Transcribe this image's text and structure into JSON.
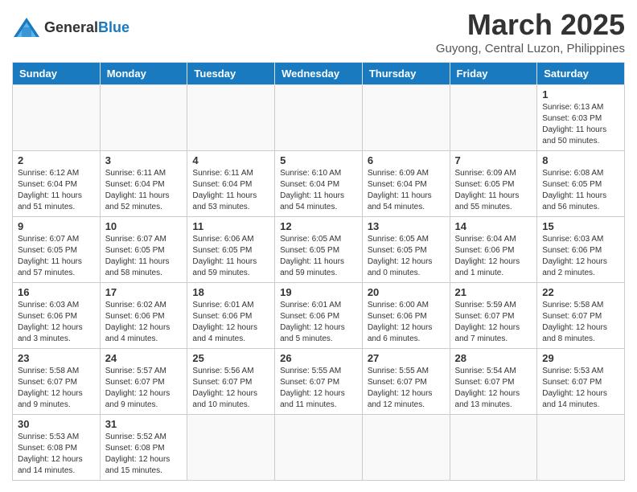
{
  "header": {
    "logo": {
      "general": "General",
      "blue": "Blue"
    },
    "title": "March 2025",
    "location": "Guyong, Central Luzon, Philippines"
  },
  "weekdays": [
    "Sunday",
    "Monday",
    "Tuesday",
    "Wednesday",
    "Thursday",
    "Friday",
    "Saturday"
  ],
  "weeks": [
    [
      {
        "day": "",
        "info": ""
      },
      {
        "day": "",
        "info": ""
      },
      {
        "day": "",
        "info": ""
      },
      {
        "day": "",
        "info": ""
      },
      {
        "day": "",
        "info": ""
      },
      {
        "day": "",
        "info": ""
      },
      {
        "day": "1",
        "info": "Sunrise: 6:13 AM\nSunset: 6:03 PM\nDaylight: 11 hours\nand 50 minutes."
      }
    ],
    [
      {
        "day": "2",
        "info": "Sunrise: 6:12 AM\nSunset: 6:04 PM\nDaylight: 11 hours\nand 51 minutes."
      },
      {
        "day": "3",
        "info": "Sunrise: 6:11 AM\nSunset: 6:04 PM\nDaylight: 11 hours\nand 52 minutes."
      },
      {
        "day": "4",
        "info": "Sunrise: 6:11 AM\nSunset: 6:04 PM\nDaylight: 11 hours\nand 53 minutes."
      },
      {
        "day": "5",
        "info": "Sunrise: 6:10 AM\nSunset: 6:04 PM\nDaylight: 11 hours\nand 54 minutes."
      },
      {
        "day": "6",
        "info": "Sunrise: 6:09 AM\nSunset: 6:04 PM\nDaylight: 11 hours\nand 54 minutes."
      },
      {
        "day": "7",
        "info": "Sunrise: 6:09 AM\nSunset: 6:05 PM\nDaylight: 11 hours\nand 55 minutes."
      },
      {
        "day": "8",
        "info": "Sunrise: 6:08 AM\nSunset: 6:05 PM\nDaylight: 11 hours\nand 56 minutes."
      }
    ],
    [
      {
        "day": "9",
        "info": "Sunrise: 6:07 AM\nSunset: 6:05 PM\nDaylight: 11 hours\nand 57 minutes."
      },
      {
        "day": "10",
        "info": "Sunrise: 6:07 AM\nSunset: 6:05 PM\nDaylight: 11 hours\nand 58 minutes."
      },
      {
        "day": "11",
        "info": "Sunrise: 6:06 AM\nSunset: 6:05 PM\nDaylight: 11 hours\nand 59 minutes."
      },
      {
        "day": "12",
        "info": "Sunrise: 6:05 AM\nSunset: 6:05 PM\nDaylight: 11 hours\nand 59 minutes."
      },
      {
        "day": "13",
        "info": "Sunrise: 6:05 AM\nSunset: 6:05 PM\nDaylight: 12 hours\nand 0 minutes."
      },
      {
        "day": "14",
        "info": "Sunrise: 6:04 AM\nSunset: 6:06 PM\nDaylight: 12 hours\nand 1 minute."
      },
      {
        "day": "15",
        "info": "Sunrise: 6:03 AM\nSunset: 6:06 PM\nDaylight: 12 hours\nand 2 minutes."
      }
    ],
    [
      {
        "day": "16",
        "info": "Sunrise: 6:03 AM\nSunset: 6:06 PM\nDaylight: 12 hours\nand 3 minutes."
      },
      {
        "day": "17",
        "info": "Sunrise: 6:02 AM\nSunset: 6:06 PM\nDaylight: 12 hours\nand 4 minutes."
      },
      {
        "day": "18",
        "info": "Sunrise: 6:01 AM\nSunset: 6:06 PM\nDaylight: 12 hours\nand 4 minutes."
      },
      {
        "day": "19",
        "info": "Sunrise: 6:01 AM\nSunset: 6:06 PM\nDaylight: 12 hours\nand 5 minutes."
      },
      {
        "day": "20",
        "info": "Sunrise: 6:00 AM\nSunset: 6:06 PM\nDaylight: 12 hours\nand 6 minutes."
      },
      {
        "day": "21",
        "info": "Sunrise: 5:59 AM\nSunset: 6:07 PM\nDaylight: 12 hours\nand 7 minutes."
      },
      {
        "day": "22",
        "info": "Sunrise: 5:58 AM\nSunset: 6:07 PM\nDaylight: 12 hours\nand 8 minutes."
      }
    ],
    [
      {
        "day": "23",
        "info": "Sunrise: 5:58 AM\nSunset: 6:07 PM\nDaylight: 12 hours\nand 9 minutes."
      },
      {
        "day": "24",
        "info": "Sunrise: 5:57 AM\nSunset: 6:07 PM\nDaylight: 12 hours\nand 9 minutes."
      },
      {
        "day": "25",
        "info": "Sunrise: 5:56 AM\nSunset: 6:07 PM\nDaylight: 12 hours\nand 10 minutes."
      },
      {
        "day": "26",
        "info": "Sunrise: 5:55 AM\nSunset: 6:07 PM\nDaylight: 12 hours\nand 11 minutes."
      },
      {
        "day": "27",
        "info": "Sunrise: 5:55 AM\nSunset: 6:07 PM\nDaylight: 12 hours\nand 12 minutes."
      },
      {
        "day": "28",
        "info": "Sunrise: 5:54 AM\nSunset: 6:07 PM\nDaylight: 12 hours\nand 13 minutes."
      },
      {
        "day": "29",
        "info": "Sunrise: 5:53 AM\nSunset: 6:07 PM\nDaylight: 12 hours\nand 14 minutes."
      }
    ],
    [
      {
        "day": "30",
        "info": "Sunrise: 5:53 AM\nSunset: 6:08 PM\nDaylight: 12 hours\nand 14 minutes."
      },
      {
        "day": "31",
        "info": "Sunrise: 5:52 AM\nSunset: 6:08 PM\nDaylight: 12 hours\nand 15 minutes."
      },
      {
        "day": "",
        "info": ""
      },
      {
        "day": "",
        "info": ""
      },
      {
        "day": "",
        "info": ""
      },
      {
        "day": "",
        "info": ""
      },
      {
        "day": "",
        "info": ""
      }
    ]
  ]
}
